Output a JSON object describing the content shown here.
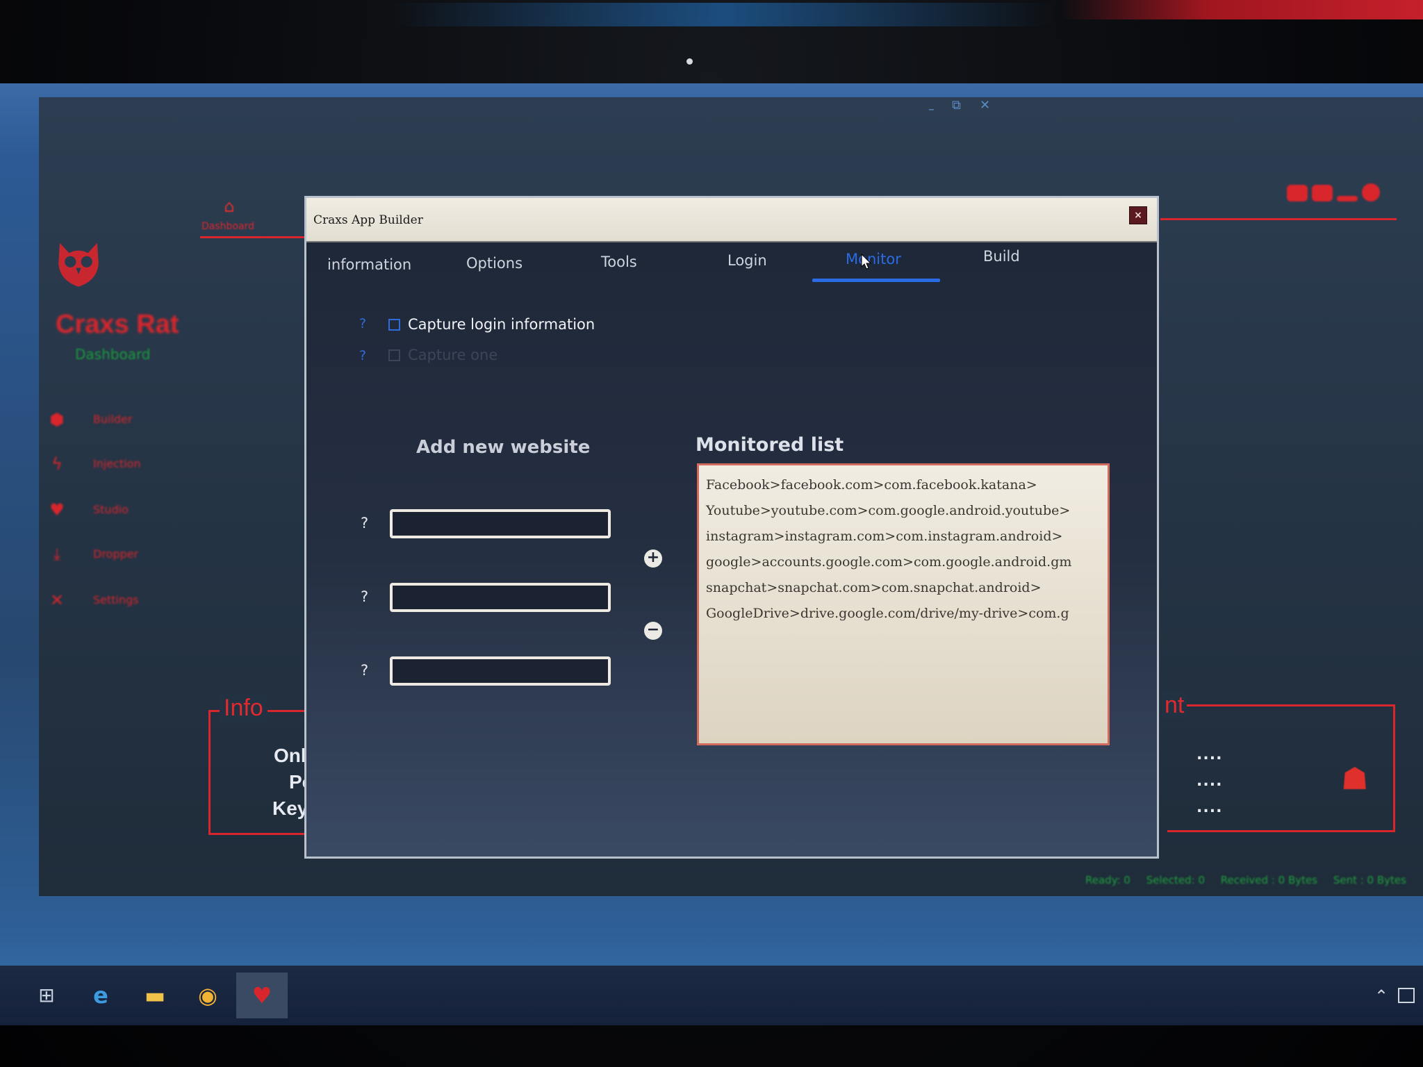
{
  "main_app": {
    "name": "Craxs Rat",
    "subtitle": "Dashboard",
    "nav": {
      "dashboard_label": "Dashboard",
      "icons": [
        "home-icon",
        "user-icon",
        "bell-icon",
        "list-icon",
        "plug-icon",
        "ban-icon"
      ]
    },
    "sidebar": {
      "items": [
        {
          "label": "Builder",
          "icon": "android-icon"
        },
        {
          "label": "Injection",
          "icon": "bolt-icon"
        },
        {
          "label": "Studio",
          "icon": "heart-icon"
        },
        {
          "label": "Dropper",
          "icon": "download-icon"
        },
        {
          "label": "Settings",
          "icon": "tools-icon"
        }
      ]
    },
    "info_panel": {
      "title": "Info",
      "lines": [
        "Onli",
        "Po",
        "Key"
      ]
    },
    "client_panel": {
      "title": "nt",
      "dots": [
        "....",
        "....",
        "...."
      ]
    },
    "status_bar": {
      "ready": "Ready: 0",
      "selected": "Selected: 0",
      "received": "Received : 0 Bytes",
      "sent": "Sent : 0 Bytes"
    },
    "accent_color": "#d9262c"
  },
  "builder": {
    "title": "Craxs App Builder",
    "close_label": "×",
    "tabs": [
      {
        "label": "information"
      },
      {
        "label": "Options"
      },
      {
        "label": "Tools"
      },
      {
        "label": "Login"
      },
      {
        "label": "Monitor",
        "active": true
      },
      {
        "label": "Build"
      }
    ],
    "checkboxes": [
      {
        "help": "?",
        "label": "Capture login information",
        "checked": false
      },
      {
        "help": "?",
        "label": "Capture one",
        "checked": false,
        "disabled": true
      }
    ],
    "add_website": {
      "title": "Add new website",
      "fields": [
        {
          "help": "?",
          "value": ""
        },
        {
          "help": "?",
          "value": ""
        },
        {
          "help": "?",
          "value": ""
        }
      ],
      "add_button": "+",
      "remove_button": "−"
    },
    "monitored": {
      "title": "Monitored list",
      "items": [
        "Facebook>facebook.com>com.facebook.katana>",
        "Youtube>youtube.com>com.google.android.youtube>",
        "instagram>instagram.com>com.instagram.android>",
        "google>accounts.google.com>com.google.android.gm",
        "snapchat>snapchat.com>com.snapchat.android>",
        "GoogleDrive>drive.google.com/drive/my-drive>com.g"
      ]
    },
    "active_tab_color": "#2a6ce6"
  },
  "taskbar": {
    "icons": [
      "task-view-icon",
      "internet-explorer-icon",
      "file-explorer-icon",
      "chrome-icon",
      "craxs-rat-icon"
    ]
  }
}
